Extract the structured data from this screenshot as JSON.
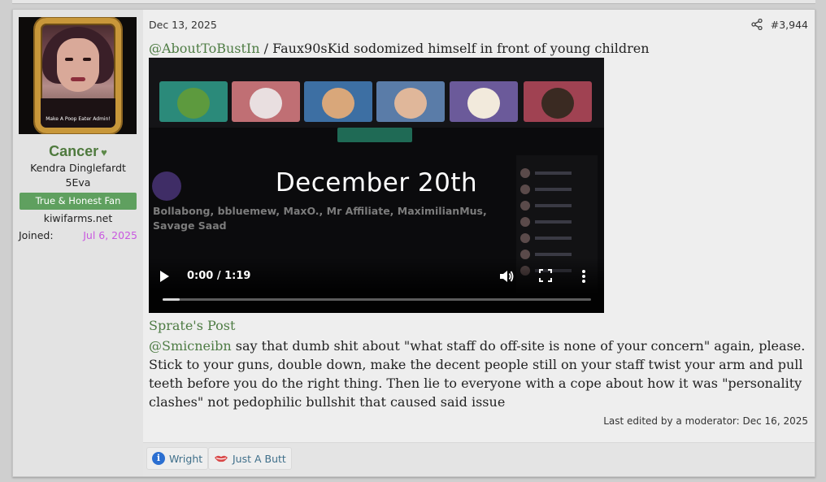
{
  "post": {
    "date": "Dec 13, 2025",
    "post_number": "#3,944",
    "icons": {
      "share": "share-icon"
    }
  },
  "user": {
    "name": "Cancer",
    "heart": "♥",
    "title_line1": "Kendra Dinglefardt",
    "title_line2": "5Eva",
    "banner": "True & Honest Fan",
    "site": "kiwifarms.net",
    "joined_label": "Joined:",
    "joined_value": "Jul 6, 2025",
    "avatar_caption": "Make A Poop Eater Admin!",
    "colors": {
      "name": "#4f7a3e",
      "banner": "#5fa05f",
      "joined": "#c958e0"
    }
  },
  "message": {
    "mention": "@AboutToBustIn",
    "text": " / Faux90sKid sodomized himself in front of young children"
  },
  "video": {
    "title": "December 20th",
    "subtitle": "Bollabong, bbluemew, MaxO., Mr Affiliate, MaximilianMus, Savage Saad",
    "time": "0:00 / 1:19",
    "progress": 0.04,
    "icons": {
      "play": "play-icon",
      "volume": "volume-icon",
      "fullscreen": "fullscreen-icon",
      "more": "more-vertical-icon"
    }
  },
  "quote": {
    "source": "Sprate's Post",
    "mention": "@Smicneibn",
    "text": " say that dumb shit about \"what staff do off-site is none of your concern\" again, please. Stick to your guns, double down, make the decent people still on your staff twist your arm and pull teeth before you do the right thing. Then lie to everyone with a cope about how it was \"personality clashes\" not pedophilic bullshit that caused said issue"
  },
  "edited": "Last edited by a moderator: Dec 16, 2025",
  "reactions": [
    {
      "label": "Wright",
      "icon": "info-icon"
    },
    {
      "label": "Just A Butt",
      "icon": "lips-icon"
    }
  ]
}
